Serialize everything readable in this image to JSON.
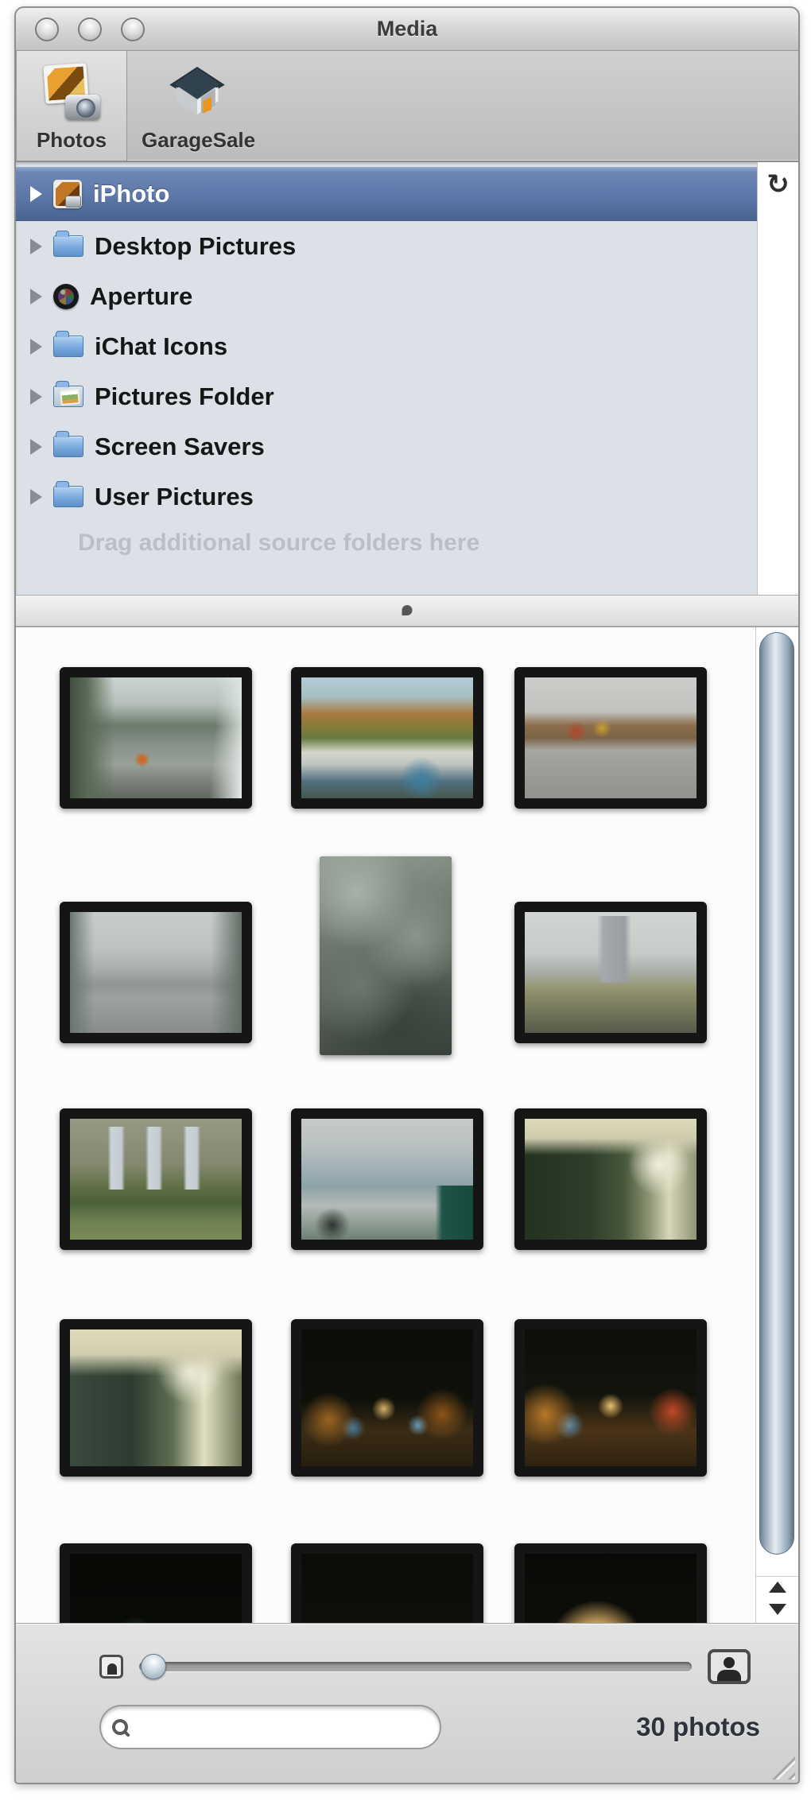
{
  "window": {
    "title": "Media"
  },
  "toolbar": {
    "items": [
      {
        "label": "Photos",
        "icon": "photos-icon",
        "selected": true
      },
      {
        "label": "GarageSale",
        "icon": "garagesale-icon",
        "selected": false
      }
    ]
  },
  "source_list": {
    "items": [
      {
        "label": "iPhoto",
        "icon": "iphoto-icon",
        "selected": true
      },
      {
        "label": "Desktop Pictures",
        "icon": "folder-icon",
        "selected": false
      },
      {
        "label": "Aperture",
        "icon": "aperture-icon",
        "selected": false
      },
      {
        "label": "iChat Icons",
        "icon": "folder-icon",
        "selected": false
      },
      {
        "label": "Pictures Folder",
        "icon": "pictures-folder-icon",
        "selected": false
      },
      {
        "label": "Screen Savers",
        "icon": "folder-icon",
        "selected": false
      },
      {
        "label": "User Pictures",
        "icon": "folder-icon",
        "selected": false
      }
    ],
    "placeholder": "Drag additional source folders here",
    "refresh_icon": "↻",
    "selected_color": "#5c78a9",
    "background_color": "#dbe1e7"
  },
  "gallery": {
    "photos": [
      {
        "name": "courtyard-with-trees",
        "style": "background:radial-gradient(circle at 42% 68%,#c86a28 0,#c86a28 2%,rgba(200,106,40,0) 6%),linear-gradient(90deg,#41503f 0,#5a6a55 10%,rgba(90,106,85,0) 26%),linear-gradient(275deg,#e8ecea 0,rgba(232,236,234,0) 18%),linear-gradient(180deg,#ccd5d2 0,#b4bfba 22%,#6b7a6d 40%,#8a948c 58%,#98a099 72%,#767e76 88%,#5f675f 100%)"
      },
      {
        "name": "autumn-trees-house-graffiti",
        "style": "background:radial-gradient(circle at 70% 84%,#3e7ea0 0,rgba(62,126,160,0) 14%),linear-gradient(180deg,#b4ccd6 0,#a6bec2 16%,#a87a3e 30%,#8a7a3a 40%,#67793f 50%,#d4d6cc 62%,#bec4be 72%,#50707e 86%,#47564c 100%)"
      },
      {
        "name": "street-corner-colorful-building",
        "style": "background:radial-gradient(circle at 30% 45%,#b04830 0,rgba(176,72,48,0) 8%),radial-gradient(circle at 45% 42%,#c8a030 0,rgba(200,160,48,0) 8%),linear-gradient(180deg,#cbcdca 0,#c0c2bf 28%,#8c6c4c 40%,#7c6448 50%,#a6a6a2 60%,#9c9e9a 75%,#90928e 100%)"
      },
      {
        "name": "campus-building-people",
        "style": "background:linear-gradient(90deg,#6a756e 0,rgba(106,117,110,0) 14%,rgba(106,117,110,0) 82%,#626d66 100%),linear-gradient(180deg,#c8cdcc 0,#bcc1c1 32%,#a6acac 48%,#909695 60%,#9ca2a0 72%,#878c8a 100%)"
      },
      {
        "name": "bare-branches-portrait",
        "style": "background:radial-gradient(circle at 28% 18%,#a8b1a8 0,rgba(168,177,168,0) 30%),radial-gradient(circle at 72% 40%,#8a948a 0,rgba(138,148,138,0) 35%),radial-gradient(circle at 30% 65%,#6d776d 0,rgba(109,119,109,0) 35%),radial-gradient(circle at 60% 88%,#39423a 0,rgba(57,66,58,0) 40%),linear-gradient(165deg,#949d94 0,#717b72 35%,#565f57 65%,#39413a 100%)"
      },
      {
        "name": "tower-autumn-trees",
        "style": "background:linear-gradient(90deg,rgba(0,0,0,0) 42%,#a2a8ac 46%,#989ea2 58%,rgba(0,0,0,0) 62%) 0 8%/100% 55% no-repeat,linear-gradient(180deg,#d2d6d3 0,#c6cbc8 34%,#aab0ac 48%,#93946e 64%,#76795c 80%,#565a48 100%)"
      },
      {
        "name": "park-lawn-banners",
        "style": "background:linear-gradient(90deg,rgba(0,0,0,0) 22%,#ccd3d8 24%,#c4ccd2 30%,rgba(0,0,0,0) 32%,rgba(0,0,0,0) 44%,#ccd3d8 46%,#c4ccd2 52%,rgba(0,0,0,0) 54%,rgba(0,0,0,0) 66%,#ccd3d8 68%,#c4ccd2 74%,rgba(0,0,0,0) 76%) 0 14%/100% 52% no-repeat,linear-gradient(180deg,#969a84 0,#83886f 38%,#5d6d42 58%,#49603a 70%,#6d8050 84%,#7a8a58 100%)"
      },
      {
        "name": "building-courtyard-scaffold",
        "style": "background:linear-gradient(90deg,rgba(0,0,0,0) 78%,#1f5448 82%,#17493e 100%) 0 100%/100% 45% no-repeat,radial-gradient(circle at 18% 88%,#2c3430 0,rgba(44,52,48,0) 10%),linear-gradient(180deg,#c6cbca 0,#b8bfbf 24%,#a2b2b6 40%,#8ca2a8 56%,#b4bab8 72%,#8a9a90 88%,#6d8076 100%)"
      },
      {
        "name": "underground-corridor",
        "style": "background:linear-gradient(180deg,#dcd8ba 0,#cfccae 16%,rgba(0,0,0,0) 30%),radial-gradient(circle at 78% 38%,#f0eedd 0,rgba(240,238,221,0) 20%),linear-gradient(90deg,#24321f 0,#2e3e2a 38%,#48583c 58%,#8a9272 72%,#d8d6b8 84%,#8e9474 100%)"
      },
      {
        "name": "underground-corridor-2",
        "style": "background:linear-gradient(180deg,#dedabc 0,#d2cfb0 18%,rgba(0,0,0,0) 34%),radial-gradient(circle at 70% 30%,#f2f0e0 0,rgba(242,240,224,0) 22%),linear-gradient(90deg,#3a4a3e 0,#2c3c30 36%,#5e6e52 60%,#e2dfc2 78%,#9aa080 92%,#6e7458 100%)"
      },
      {
        "name": "night-street-trees",
        "style": "background:radial-gradient(circle at 48% 58%,#d8b068 0,rgba(216,176,104,0) 10%),radial-gradient(circle at 16% 66%,#9a6420 0,rgba(154,100,32,0) 16%),radial-gradient(circle at 82% 62%,#8a5418 0,rgba(138,84,24,0) 16%),radial-gradient(circle at 30% 72%,#4a7a9a 0,rgba(74,122,154,0) 8%),radial-gradient(circle at 68% 70%,#6a9ab8 0,rgba(106,154,184,0) 7%),linear-gradient(180deg,#0b0d09 0,#0e100a 52%,#3a2c16 74%,#281d0e 100%)"
      },
      {
        "name": "night-street-lights",
        "style": "background:radial-gradient(circle at 50% 56%,#e8c070 0,rgba(232,192,112,0) 11%),radial-gradient(circle at 12% 62%,#b87828 0,rgba(184,120,40,0) 18%),radial-gradient(circle at 86% 60%,#c04828 0,rgba(192,72,40,0) 14%),radial-gradient(circle at 26% 70%,#5a8aaa 0,rgba(90,138,170,0) 9%),linear-gradient(180deg,#0c0e0a 0,#12140c 48%,#4a3418 74%,#2e2210 100%)"
      },
      {
        "name": "night-skyline",
        "style": "background:radial-gradient(circle at 22% 82%,#d0b878 0,rgba(208,184,120,0) 14%),radial-gradient(circle at 48% 78%,#8ab0c8 0,rgba(138,176,200,0) 9%),radial-gradient(circle at 72% 84%,#c08838 0,rgba(192,136,56,0) 12%),radial-gradient(circle at 38% 60%,#1e4a3a 0,rgba(30,74,58,0) 14%),linear-gradient(180deg,#070906 0,#0a0c08 66%,#201a0e 100%)"
      },
      {
        "name": "night-street-2",
        "style": "background:radial-gradient(circle at 44% 74%,#e0c078 0,rgba(224,192,120,0) 12%),radial-gradient(circle at 14% 78%,#b87828 0,rgba(184,120,40,0) 16%),radial-gradient(circle at 70% 80%,#4a8a52 0,rgba(74,138,82,0) 8%),radial-gradient(circle at 86% 82%,#c05828 0,rgba(192,88,40,0) 12%),linear-gradient(180deg,#0a0c08 0,#0e100a 60%,#32240f 100%)"
      },
      {
        "name": "illuminated-tree-night",
        "style": "background:radial-gradient(ellipse 45% 55% at 42% 68%,#ecd8a4 0,#cfa660 30%,rgba(207,166,96,0) 62%),radial-gradient(circle at 70% 78%,#8a6830 0,rgba(138,104,48,0) 20%),linear-gradient(180deg,#090a07 0,#12100a 100%)"
      }
    ]
  },
  "statusbar": {
    "photo_count": "30 photos",
    "search_value": "",
    "search_placeholder": "",
    "thumbnail_slider_position": "min"
  }
}
